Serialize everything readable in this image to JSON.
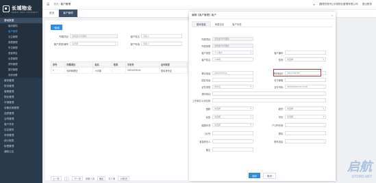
{
  "brand": {
    "name": "长城物业",
    "subtitle": "GREAT WALL PROPERTY"
  },
  "sidebar": {
    "items": [
      {
        "label": "基础数据",
        "active": true
      },
      {
        "label": "组织架构",
        "sub": true
      },
      {
        "label": "客户管理",
        "sub": true,
        "active": true
      },
      {
        "label": "业主管理",
        "sub": true
      },
      {
        "label": "房屋管理",
        "sub": true
      },
      {
        "label": "车位管理",
        "sub": true
      },
      {
        "label": "收费项目",
        "sub": true
      },
      {
        "label": "仪表管理",
        "sub": true
      },
      {
        "label": "资料管理",
        "sub": true
      },
      {
        "label": "楼宇管理",
        "sub": true
      },
      {
        "label": "系统设置",
        "sub": true
      },
      {
        "label": "服务管理"
      },
      {
        "label": "财务管理"
      },
      {
        "label": "客服管理"
      },
      {
        "label": "物业管理"
      },
      {
        "label": "环境管理"
      },
      {
        "label": "设备设施管理"
      },
      {
        "label": "品质管理"
      },
      {
        "label": "合同管理"
      },
      {
        "label": "客户关系"
      },
      {
        "label": "社区服务"
      },
      {
        "label": "系统管理"
      },
      {
        "label": "统计报表"
      },
      {
        "label": "权限管理"
      },
      {
        "label": "通知公告"
      }
    ]
  },
  "topbar": {
    "breadcrumb_home": "首页",
    "breadcrumb_sep": "/",
    "breadcrumb_current": "客户管理",
    "user_text": "[管理员账号] 长城物业管理有限公司",
    "logout": "退出登录"
  },
  "tabs": [
    {
      "label": "首页",
      "on": false
    },
    {
      "label": "客户管理",
      "on": true
    }
  ],
  "list": {
    "add_button": "+新增",
    "filters": {
      "project_label": "所属项目",
      "project_value": "深圳金湾/管理处",
      "name_label": "客户姓名",
      "name_placeholder": "请输入",
      "type_label": "客户类型/编号",
      "type_value": "请选择",
      "phone_label": "客户电话",
      "phone_placeholder": "请输入"
    },
    "columns": [
      "序号",
      "所属项目",
      "姓名",
      "性别",
      "手机号",
      "证件类型"
    ],
    "rows": [
      {
        "no": "1",
        "project": "深圳管理处",
        "name": "小青春",
        "gender": "",
        "phone": "18210678244",
        "id_type": "居民身份证"
      }
    ],
    "pager": {
      "prev": "上一页",
      "page": "1",
      "next": "下一页",
      "goto": "到第 1 页",
      "confirm": "确定",
      "total": "共 1 条",
      "size": "10条/页"
    }
  },
  "modal": {
    "title": "编辑【客户管理】客户",
    "tabs": [
      {
        "label": "基本信息",
        "on": true
      },
      {
        "label": "房屋信息",
        "on": false
      },
      {
        "label": "客户标签",
        "on": false
      }
    ],
    "fields": {
      "project_label": "所属项目:",
      "project_value": "深圳金湾/管理处",
      "house_label": "所属房屋:",
      "house_value": "深圳金湾/管理处",
      "cust_type_label": "客户类型:",
      "cust_type_value": "个人客户",
      "cust_no_label": "客户编号:",
      "cust_no_value": "",
      "name_label": "客户姓名:",
      "name_value": "小青春",
      "gender_label": "性别:",
      "gender_value": "请选择",
      "phone_label": "移动电话:",
      "phone_value": "18210678244",
      "phone2_label": "移动电话2:",
      "phone2_value": "15017345755",
      "tel_label": "固定电话:",
      "tel_value": "",
      "email_label": "电子邮箱:",
      "email_value": "",
      "id_type_label": "证件类型:",
      "id_type_value": "身份证",
      "id_no_label": "证件号码:",
      "id_no_value": "440306198702172236",
      "address_label": "通讯地址:",
      "address_value": "",
      "company_label": "工作单位/公司名称:",
      "company_value": "",
      "nation_label": "国籍:",
      "nation_value": "请选择",
      "origin_label": "籍贯:",
      "origin_value": "请选择",
      "ethnic_label": "民族:",
      "ethnic_value": "请选择",
      "edu_label": "学历:",
      "edu_value": "请选择",
      "marital_label": "婚姻状况:",
      "marital_value": "请选择",
      "birth_label": "户口所在地:",
      "birth_value": "",
      "qq_label": "QQ号:",
      "qq_value": "",
      "wechat_label": "微信:",
      "wechat_value": "",
      "emergency_label": "紧急联系人:",
      "emergency_value": "",
      "emergency_phone_label": "联系电话:",
      "emergency_phone_value": "",
      "remark_label": "备注:",
      "remark_value": ""
    },
    "save": "保存",
    "cancel": "取消"
  },
  "watermark": {
    "big": "启航",
    "small": "DTCMS.NET"
  }
}
